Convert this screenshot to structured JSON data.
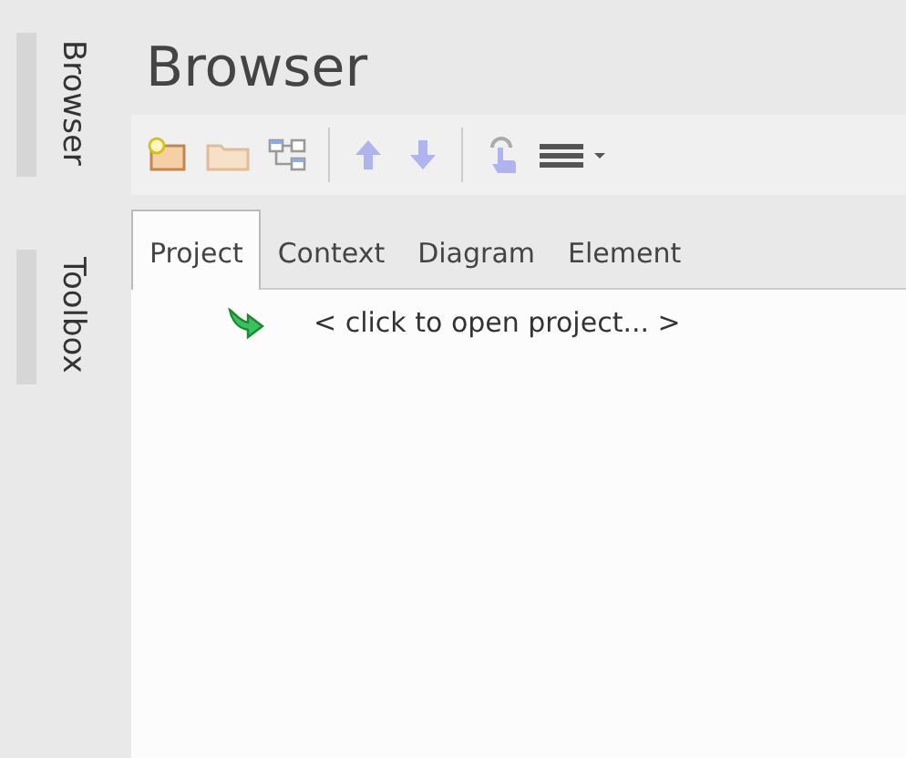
{
  "side_tabs": [
    {
      "label": "Browser"
    },
    {
      "label": "Toolbox"
    }
  ],
  "panel": {
    "title": "Browser"
  },
  "toolbar": [
    {
      "kind": "new-package"
    },
    {
      "kind": "folder"
    },
    {
      "kind": "hierarchy"
    },
    {
      "kind": "separator"
    },
    {
      "kind": "up"
    },
    {
      "kind": "down"
    },
    {
      "kind": "separator"
    },
    {
      "kind": "touch"
    },
    {
      "kind": "menu"
    }
  ],
  "tabs": [
    {
      "label": "Project",
      "selected": true
    },
    {
      "label": "Context",
      "selected": false
    },
    {
      "label": "Diagram",
      "selected": false
    },
    {
      "label": "Element",
      "selected": false
    }
  ],
  "tree": {
    "prompt": "< click to open project... >"
  }
}
